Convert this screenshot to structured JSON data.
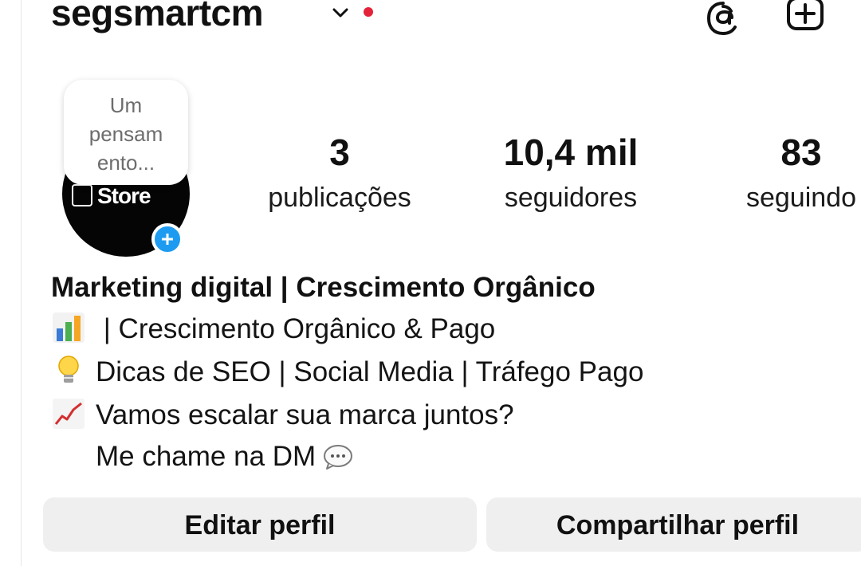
{
  "profile": {
    "username": "segsmartcm"
  },
  "note": {
    "lines": [
      "Um",
      "pensam",
      "ento..."
    ]
  },
  "avatar": {
    "logo_text": "Store"
  },
  "stats": [
    {
      "number": "3",
      "label": "publicações"
    },
    {
      "number": "10,4 mil",
      "label": "seguidores"
    },
    {
      "number": "83",
      "label": "seguindo"
    }
  ],
  "bio": {
    "name": "Marketing digital  | Crescimento Orgânico",
    "lines": [
      {
        "icon": "bar-chart-emoji",
        "text": " | Crescimento Orgânico & Pago"
      },
      {
        "icon": "light-bulb-emoji",
        "text": "Dicas de SEO | Social Media | Tráfego Pago"
      },
      {
        "icon": "chart-increasing-emoji",
        "text": "Vamos escalar sua marca juntos?"
      },
      {
        "icon": "speech-bubble-emoji",
        "text": "Me chame na DM"
      }
    ]
  },
  "buttons": {
    "edit": "Editar perfil",
    "share": "Compartilhar perfil"
  },
  "colors": {
    "notification_dot": "#e4233a",
    "add_story_badge": "#1d9bf0",
    "button_bg": "#efefef"
  }
}
